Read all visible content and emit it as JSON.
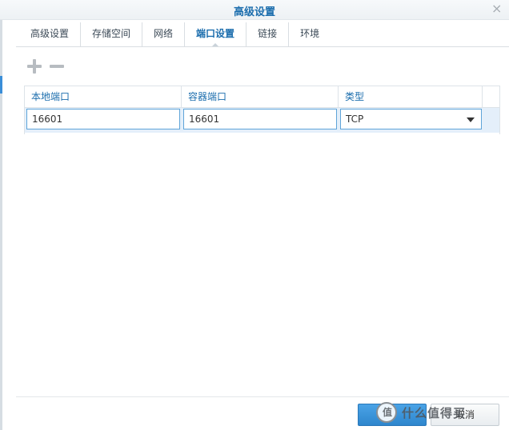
{
  "window": {
    "title": "高级设置",
    "close_glyph": "×"
  },
  "tabs": [
    {
      "label": "高级设置",
      "active": false
    },
    {
      "label": "存储空间",
      "active": false
    },
    {
      "label": "网络",
      "active": false
    },
    {
      "label": "端口设置",
      "active": true
    },
    {
      "label": "链接",
      "active": false
    },
    {
      "label": "环境",
      "active": false
    }
  ],
  "toolbar": {
    "add_icon": "plus-icon",
    "remove_icon": "minus-icon"
  },
  "table": {
    "headers": [
      "本地端口",
      "容器端口",
      "类型"
    ],
    "rows": [
      {
        "local_port": "16601",
        "container_port": "16601",
        "type": "TCP"
      }
    ]
  },
  "footer": {
    "ok_label": "",
    "cancel_label": "取消"
  },
  "watermark": {
    "logo_glyph": "值",
    "text": "什么值得买"
  },
  "colors": {
    "accent": "#1b6dad",
    "primary_button": "#2e86cd",
    "row_selected": "#e4effa"
  }
}
